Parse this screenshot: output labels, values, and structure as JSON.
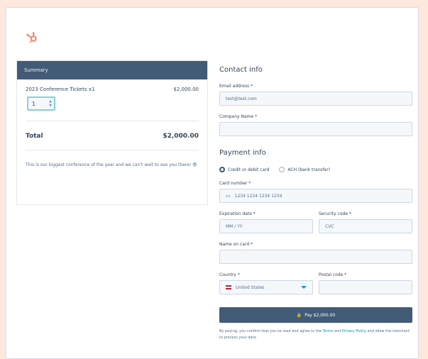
{
  "colors": {
    "page_background": "#fde8dd",
    "accent": "#425b76",
    "logo": "#ff7a59",
    "focus_border": "#7fd1de"
  },
  "logo": {
    "icon": "hubspot-sprocket-icon"
  },
  "summary": {
    "header": "Summary",
    "line_item_name": "2023 Conference Tickets x1",
    "line_item_price": "$2,000.00",
    "quantity": "1",
    "total_label": "Total",
    "total_value": "$2,000.00",
    "note": "This is our biggest conference of the year and we can't wait to see you there! 😎"
  },
  "contact": {
    "title": "Contact info",
    "email_label": "Email address *",
    "email_value": "test@test.com",
    "company_label": "Company Name *",
    "company_value": ""
  },
  "payment": {
    "title": "Payment info",
    "method_card": "Credit or debit card",
    "method_ach": "ACH (bank transfer)",
    "card_number_label": "Card number *",
    "card_number_placeholder": "1234 1234 1234 1234",
    "expiry_label": "Expiration date *",
    "expiry_placeholder": "MM / YY",
    "cvc_label": "Security code *",
    "cvc_placeholder": "CVC",
    "name_label": "Name on card *",
    "country_label": "Country *",
    "country_value": "United States",
    "postal_label": "Postal code *",
    "pay_button": "Pay $2,000.00",
    "terms_text": "By paying, you confirm that you've read and agree to the",
    "terms_link": "Terms",
    "privacy_link": "Privacy Policy",
    "terms_suffix": "and allow the merchant to process your data."
  }
}
